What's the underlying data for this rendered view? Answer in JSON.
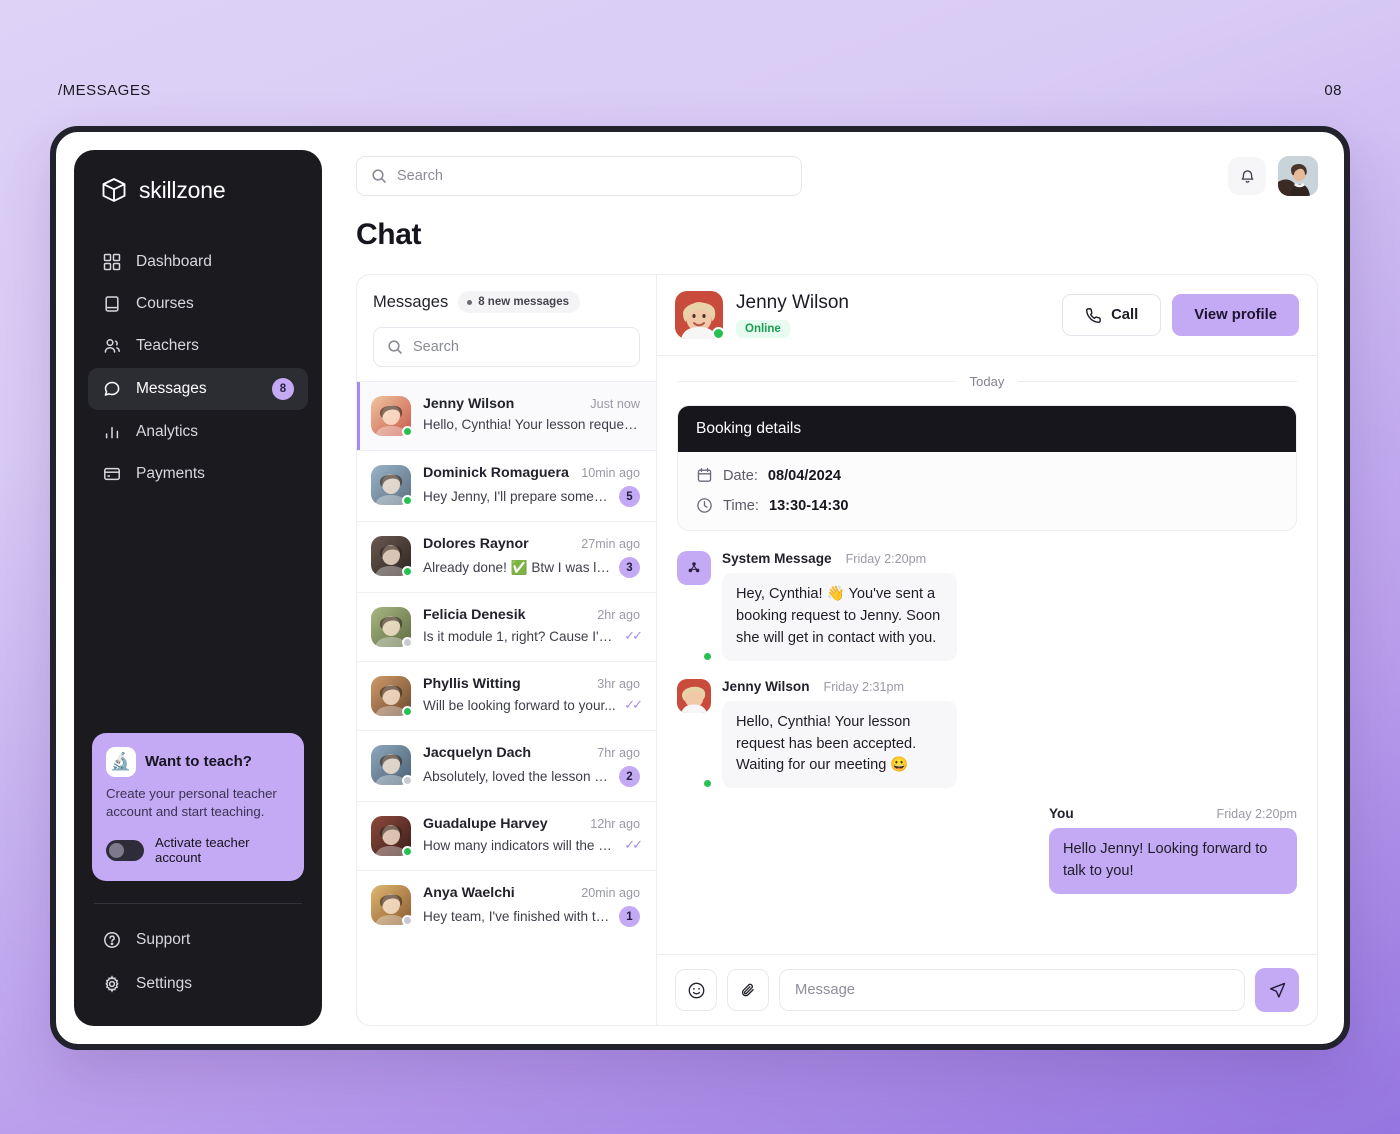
{
  "page": {
    "label_left": "/MESSAGES",
    "label_right": "08"
  },
  "sidebar": {
    "brand": "skillzone",
    "items": [
      {
        "label": "Dashboard",
        "icon": "grid-icon",
        "badge": ""
      },
      {
        "label": "Courses",
        "icon": "book-icon",
        "badge": ""
      },
      {
        "label": "Teachers",
        "icon": "users-icon",
        "badge": ""
      },
      {
        "label": "Messages",
        "icon": "chat-bubble-icon",
        "badge": "8"
      },
      {
        "label": "Analytics",
        "icon": "bar-chart-icon",
        "badge": ""
      },
      {
        "label": "Payments",
        "icon": "credit-card-icon",
        "badge": ""
      }
    ],
    "promo": {
      "emoji": "🔬",
      "title": "Want to teach?",
      "description": "Create your personal teacher account and start teaching.",
      "toggle_label": "Activate teacher account",
      "toggle_on": false
    },
    "bottom": [
      {
        "label": "Support",
        "icon": "help-circle-icon"
      },
      {
        "label": "Settings",
        "icon": "gear-icon"
      }
    ]
  },
  "topbar": {
    "search_placeholder": "Search",
    "search_value": "",
    "notification_icon": "bell-icon",
    "avatar_icon": "user-avatar"
  },
  "main": {
    "title": "Chat"
  },
  "conversations": {
    "header": "Messages",
    "new_pill": "8 new messages",
    "search_placeholder": "Search",
    "search_value": "",
    "items": [
      {
        "name": "Jenny Wilson",
        "time": "Just now",
        "preview": "Hello, Cynthia! Your lesson request...",
        "badge": "",
        "read_status": "",
        "online": true,
        "selected": true,
        "avatar_from": "#f0c4a0",
        "avatar_to": "#c85a4a"
      },
      {
        "name": "Dominick Romaguera",
        "time": "10min ago",
        "preview": "Hey Jenny, I'll prepare some to...",
        "badge": "5",
        "read_status": "",
        "online": true,
        "selected": false,
        "avatar_from": "#9ab4c8",
        "avatar_to": "#5c6f80"
      },
      {
        "name": "Dolores Raynor",
        "time": "27min ago",
        "preview": "Already done! ✅ Btw I was loo...",
        "badge": "3",
        "read_status": "",
        "online": true,
        "selected": false,
        "avatar_from": "#6b5a52",
        "avatar_to": "#2c2420"
      },
      {
        "name": "Felicia Denesik",
        "time": "2hr ago",
        "preview": "Is it module 1, right? Cause I've...",
        "badge": "",
        "read_status": "✓✓",
        "online": false,
        "selected": false,
        "avatar_from": "#a8b882",
        "avatar_to": "#5e6b42"
      },
      {
        "name": "Phyllis Witting",
        "time": "3hr ago",
        "preview": "Will be looking forward to your...",
        "badge": "",
        "read_status": "✓✓",
        "online": true,
        "selected": false,
        "avatar_from": "#d19a6a",
        "avatar_to": "#6b4a30"
      },
      {
        "name": "Jacquelyn Dach",
        "time": "7hr ago",
        "preview": "Absolutely, loved the lesson 🙌...",
        "badge": "2",
        "read_status": "",
        "online": false,
        "selected": false,
        "avatar_from": "#8fa8bd",
        "avatar_to": "#4a5f72"
      },
      {
        "name": "Guadalupe Harvey",
        "time": "12hr ago",
        "preview": "How many indicators will the s...",
        "badge": "",
        "read_status": "✓✓",
        "online": true,
        "selected": false,
        "avatar_from": "#8e4a3c",
        "avatar_to": "#3a1d18"
      },
      {
        "name": "Anya Waelchi",
        "time": "20min ago",
        "preview": "Hey team, I've finished with th...",
        "badge": "1",
        "read_status": "",
        "online": false,
        "selected": false,
        "avatar_from": "#e0b870",
        "avatar_to": "#8a5a30"
      }
    ]
  },
  "chat": {
    "contact_name": "Jenny Wilson",
    "status": "Online",
    "call_label": "Call",
    "profile_label": "View profile",
    "day_separator": "Today",
    "booking": {
      "title": "Booking details",
      "date_label": "Date:",
      "date_value": "08/04/2024",
      "time_label": "Time:",
      "time_value": "13:30-14:30"
    },
    "messages": [
      {
        "author": "System Message",
        "time": "Friday 2:20pm",
        "text": "Hey, Cynthia! 👋 You've sent a booking request to Jenny. Soon she will get in contact with you.",
        "self": false,
        "system": true
      },
      {
        "author": "Jenny Wilson",
        "time": "Friday 2:31pm",
        "text": "Hello, Cynthia! Your lesson request has been accepted. Waiting for our meeting 😀",
        "self": false,
        "system": false
      },
      {
        "author": "You",
        "time": "Friday 2:20pm",
        "text": "Hello Jenny! Looking forward to talk to you!",
        "self": true,
        "system": false
      }
    ],
    "composer": {
      "emoji_icon": "smiley-icon",
      "attach_icon": "paperclip-icon",
      "placeholder": "Message",
      "value": "",
      "send_icon": "send-icon"
    }
  },
  "colors": {
    "accent": "#c4a9f5",
    "sidebar_bg": "#1a1a1f",
    "online": "#27c151",
    "offline": "#c9c9d2"
  }
}
